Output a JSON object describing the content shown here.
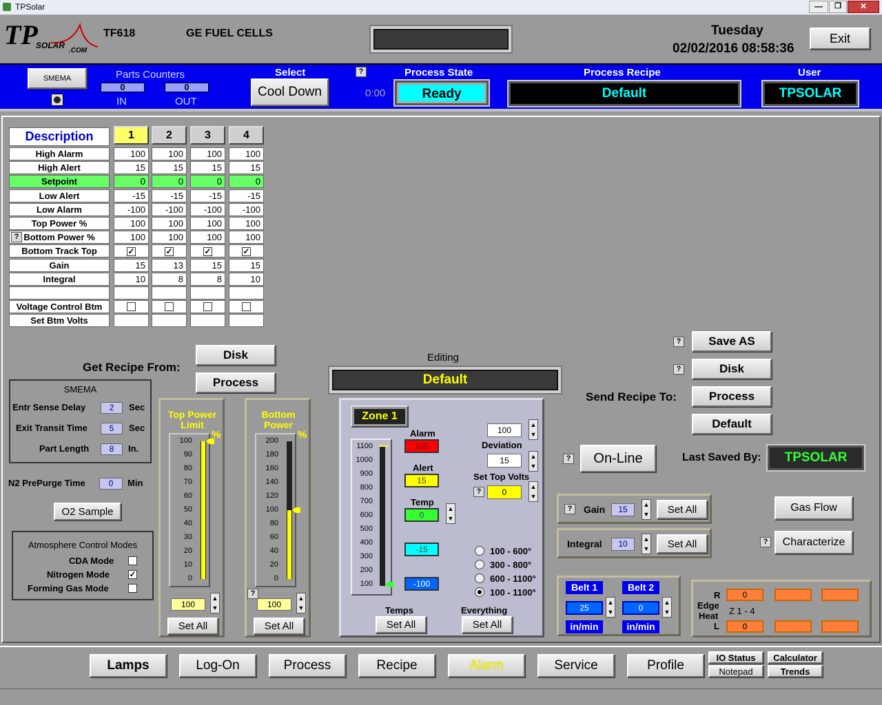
{
  "window": {
    "title": "TPSolar"
  },
  "header": {
    "model": "TF618",
    "customer": "GE FUEL CELLS",
    "day": "Tuesday",
    "datetime": "02/02/2016 08:58:36",
    "exit_label": "Exit"
  },
  "statusbar": {
    "smema_label": "SMEMA",
    "parts_counters_label": "Parts Counters",
    "in_value": "0",
    "in_label": "IN",
    "out_value": "0",
    "out_label": "OUT",
    "select_label": "Select",
    "select_value": "Cool Down",
    "timer": "0:00",
    "process_state_label": "Process State",
    "process_state": "Ready",
    "process_recipe_label": "Process Recipe",
    "process_recipe": "Default",
    "user_label": "User",
    "user": "TPSOLAR"
  },
  "table": {
    "description_label": "Description",
    "zones": [
      "1",
      "2",
      "3",
      "4"
    ],
    "rows": [
      {
        "label": "High Alarm",
        "values": [
          "100",
          "100",
          "100",
          "100"
        ]
      },
      {
        "label": "High Alert",
        "values": [
          "15",
          "15",
          "15",
          "15"
        ]
      },
      {
        "label": "Setpoint",
        "values": [
          "0",
          "0",
          "0",
          "0"
        ]
      },
      {
        "label": "Low Alert",
        "values": [
          "-15",
          "-15",
          "-15",
          "-15"
        ]
      },
      {
        "label": "Low Alarm",
        "values": [
          "-100",
          "-100",
          "-100",
          "-100"
        ]
      },
      {
        "label": "Top Power %",
        "values": [
          "100",
          "100",
          "100",
          "100"
        ]
      },
      {
        "label": "Bottom Power %",
        "values": [
          "100",
          "100",
          "100",
          "100"
        ]
      },
      {
        "label": "Bottom Track Top",
        "values": [
          "✓",
          "✓",
          "✓",
          "✓"
        ]
      },
      {
        "label": "Gain",
        "values": [
          "15",
          "13",
          "15",
          "15"
        ]
      },
      {
        "label": "Integral",
        "values": [
          "10",
          "8",
          "8",
          "10"
        ]
      },
      {
        "label": "",
        "values": [
          "",
          "",
          "",
          ""
        ]
      },
      {
        "label": "Voltage Control Btm",
        "values": [
          "",
          "",
          "",
          ""
        ]
      },
      {
        "label": "Set Btm Volts",
        "values": [
          "",
          "",
          "",
          ""
        ]
      }
    ]
  },
  "recipe": {
    "get_from_label": "Get Recipe From:",
    "disk": "Disk",
    "process": "Process",
    "editing_label": "Editing",
    "editing_value": "Default",
    "send_to_label": "Send Recipe To:",
    "save_as": "Save AS",
    "send_disk": "Disk",
    "send_process": "Process",
    "send_default": "Default",
    "online": "On-Line",
    "last_saved_label": "Last Saved By:",
    "last_saved_value": "TPSOLAR"
  },
  "smema": {
    "title": "SMEMA",
    "entr_label": "Entr Sense Delay",
    "entr_value": "2",
    "entr_unit": "Sec",
    "exit_label": "Exit Transit Time",
    "exit_value": "5",
    "exit_unit": "Sec",
    "part_label": "Part Length",
    "part_value": "8",
    "part_unit": "In.",
    "n2_label": "N2 PrePurge Time",
    "n2_value": "0",
    "n2_unit": "Min",
    "o2_label": "O2 Sample"
  },
  "atmosphere": {
    "title": "Atmosphere Control Modes",
    "cda": "CDA Mode",
    "nitrogen": "Nitrogen Mode",
    "nitrogen_check": "✓",
    "forming": "Forming Gas Mode"
  },
  "top_power": {
    "title": "Top Power Limit",
    "unit": "%",
    "ticks": [
      "100",
      "90",
      "80",
      "70",
      "60",
      "50",
      "40",
      "30",
      "20",
      "10",
      "0"
    ],
    "value": "100",
    "set_all": "Set All",
    "level": 1.0
  },
  "bottom_power": {
    "title": "Bottom Power",
    "unit": "%",
    "ticks": [
      "200",
      "180",
      "160",
      "140",
      "120",
      "100",
      "80",
      "60",
      "40",
      "20",
      "0"
    ],
    "value": "100",
    "set_all": "Set All",
    "level": 0.5
  },
  "zone": {
    "label": "Zone 1",
    "ticks": [
      "1100",
      "1000",
      "900",
      "800",
      "700",
      "600",
      "500",
      "400",
      "300",
      "200",
      "100"
    ],
    "alarm_label": "Alarm",
    "alarm_value": "100",
    "alert_label": "Alert",
    "alert_value": "15",
    "temp_label": "Temp",
    "temp_value": "0",
    "low_alert_value": "-15",
    "low_alarm_value": "-100",
    "deviation_value": "100",
    "deviation_label": "Deviation",
    "dev2_value": "15",
    "set_top_volts_label": "Set Top Volts",
    "set_top_volts_value": "0",
    "ranges": [
      "100 - 600°",
      "300 - 800°",
      "600 - 1100°",
      "100 - 1100°"
    ],
    "temps_label": "Temps",
    "everything_label": "Everything",
    "set_all": "Set All"
  },
  "gain": {
    "label": "Gain",
    "value": "15",
    "set_all": "Set All"
  },
  "integral": {
    "label": "Integral",
    "value": "10",
    "set_all": "Set All"
  },
  "right_buttons": {
    "gas_flow": "Gas Flow",
    "characterize": "Characterize"
  },
  "belt": {
    "belt1": "Belt 1",
    "belt1_value": "25",
    "unit1": "in/min",
    "belt2": "Belt 2",
    "belt2_value": "0",
    "unit2": "in/min"
  },
  "edge_heat": {
    "r": "R",
    "l": "L",
    "label1": "Edge",
    "label2": "Heat",
    "zones": "Z 1 - 4",
    "r_value": "0",
    "l_value": "0"
  },
  "nav": {
    "lamps": "Lamps",
    "logon": "Log-On",
    "process": "Process",
    "recipe": "Recipe",
    "alarm": "Alarm",
    "service": "Service",
    "profile": "Profile",
    "io_status": "IO Status",
    "notepad": "Notepad",
    "calculator": "Calculator",
    "trends": "Trends"
  },
  "colors": {
    "blue_bar": "#0000ee",
    "ready": "#00ffff",
    "yellow": "#ffff00",
    "green": "#33ff33",
    "orange": "#ff7f3a",
    "alarm_red": "#ff0000"
  }
}
